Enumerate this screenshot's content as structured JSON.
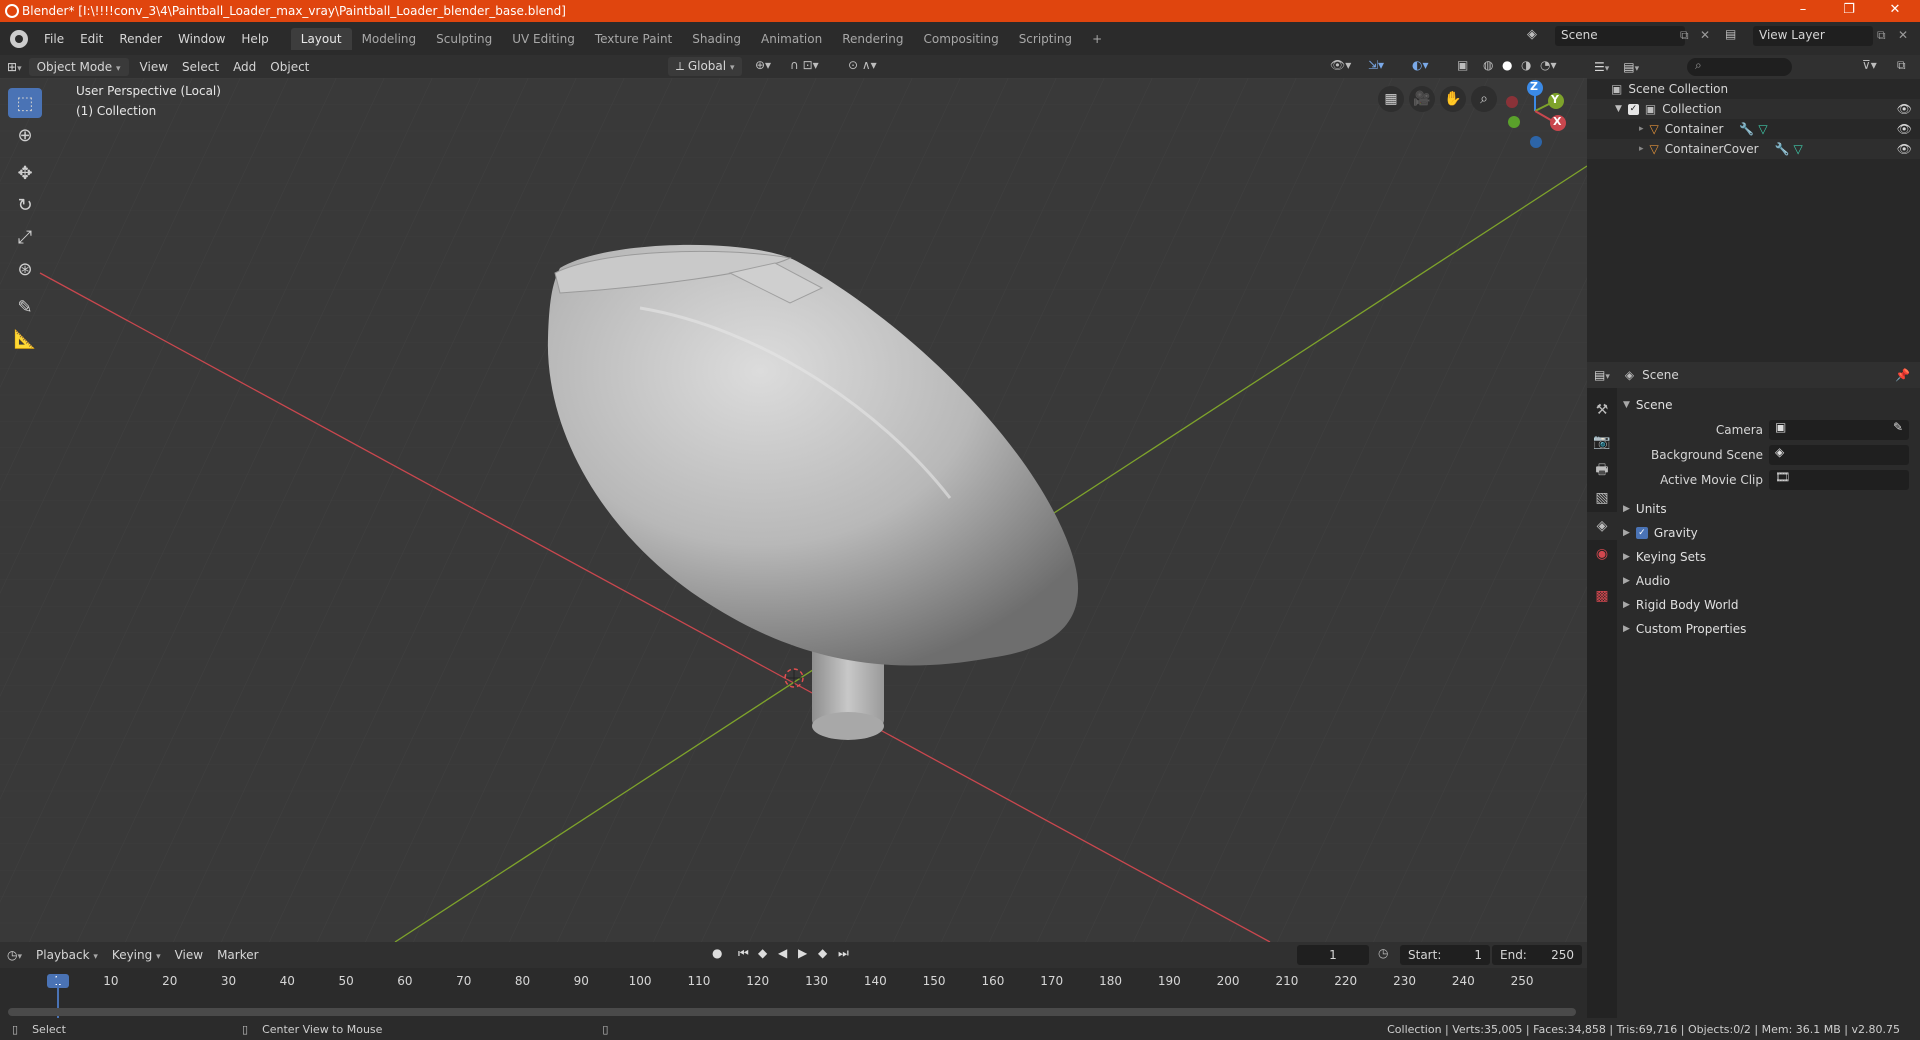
{
  "window": {
    "title": "Blender* [I:\\!!!!conv_3\\4\\Paintball_Loader_max_vray\\Paintball_Loader_blender_base.blend]",
    "controls": [
      "–",
      "❐",
      "✕"
    ]
  },
  "menu": [
    "File",
    "Edit",
    "Render",
    "Window",
    "Help"
  ],
  "workspaces": [
    "Layout",
    "Modeling",
    "Sculpting",
    "UV Editing",
    "Texture Paint",
    "Shading",
    "Animation",
    "Rendering",
    "Compositing",
    "Scripting"
  ],
  "active_workspace": "Layout",
  "add_workspace": "+",
  "scene_name": "Scene",
  "view_layer": "View Layer",
  "viewport_header": {
    "mode": "Object Mode",
    "menus": [
      "View",
      "Select",
      "Add",
      "Object"
    ],
    "orientation": "Global"
  },
  "viewport": {
    "line1": "User Perspective (Local)",
    "line2": "(1) Collection",
    "gizmo": {
      "z": "Z",
      "y": "Y",
      "x": "X"
    },
    "bg_color": "#393939",
    "model_color": "#bdbdbd",
    "x_axis_color": "#c9474e",
    "y_axis_color": "#7ea32b"
  },
  "outliner": {
    "root": "Scene Collection",
    "collection": "Collection",
    "objects": [
      "Container",
      "ContainerCover"
    ]
  },
  "properties": {
    "context": "Scene",
    "section": "Scene",
    "fields": {
      "camera": "Camera",
      "background_scene": "Background Scene",
      "active_movie_clip": "Active Movie Clip"
    },
    "panels": [
      "Units",
      "Gravity",
      "Keying Sets",
      "Audio",
      "Rigid Body World",
      "Custom Properties"
    ],
    "gravity_checked": true
  },
  "timeline": {
    "menus": [
      "Playback",
      "Keying",
      "View",
      "Marker"
    ],
    "current_frame": "1",
    "start_label": "Start:",
    "start": "1",
    "end_label": "End:",
    "end": "250",
    "ticks": [
      "1",
      "10",
      "20",
      "30",
      "40",
      "50",
      "60",
      "70",
      "80",
      "90",
      "100",
      "110",
      "120",
      "130",
      "140",
      "150",
      "160",
      "170",
      "180",
      "190",
      "200",
      "210",
      "220",
      "230",
      "240",
      "250"
    ]
  },
  "status": {
    "left_action": "Select",
    "mid_action": "Center View to Mouse",
    "stats": "Collection | Verts:35,005 | Faces:34,858 | Tris:69,716 | Objects:0/2 | Mem: 36.1 MB | v2.80.75"
  }
}
